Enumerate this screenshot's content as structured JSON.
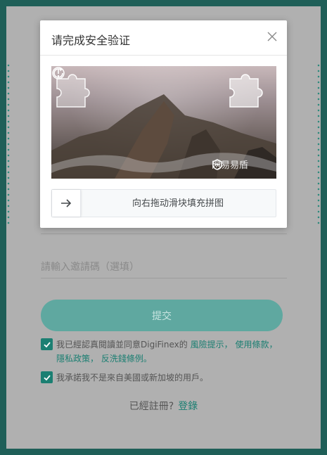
{
  "form": {
    "invite_placeholder": "請輸入邀請碼（選填）",
    "submit_label": "提交",
    "agree1_prefix": "我已經認真閱讀並同意DigiFinex的",
    "agree1_link_risk": "風險提示，",
    "agree1_link_terms": "使用條款，",
    "agree1_link_privacy": "隱私政策，",
    "agree1_link_aml": "反洗錢條例。",
    "agree2_text": "我承諾我不是來自美國或新加坡的用戶。",
    "login_prompt": "已經註冊?",
    "login_link": "登錄"
  },
  "captcha": {
    "title": "请完成安全验证",
    "slider_text": "向右拖动滑块填充拼图",
    "watermark": "网易易盾",
    "icons": {
      "close": "close-icon",
      "info": "info-icon",
      "refresh": "refresh-icon",
      "arrow": "arrow-right-icon",
      "brand": "yidun-logo-icon"
    }
  },
  "colors": {
    "accent": "#1b7f72",
    "submit_bg": "#5fa8a0",
    "page_border": "#1f5f58"
  }
}
